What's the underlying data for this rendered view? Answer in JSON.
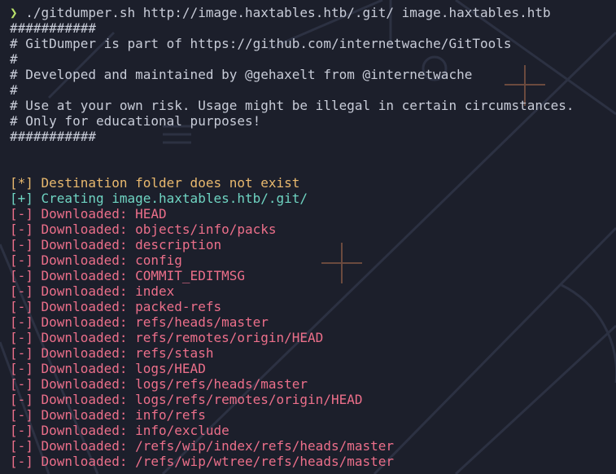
{
  "terminal": {
    "prompt_symbol": "❯",
    "command": " ./gitdumper.sh http://image.haxtables.htb/.git/ image.haxtables.htb",
    "banner": [
      "###########",
      "# GitDumper is part of https://github.com/internetwache/GitTools",
      "#",
      "# Developed and maintained by @gehaxelt from @internetwache",
      "#",
      "# Use at your own risk. Usage might be illegal in certain circumstances.",
      "# Only for educational purposes!",
      "###########"
    ],
    "warning_line": "[*] Destination folder does not exist",
    "info_line": "[+] Creating image.haxtables.htb/.git/",
    "download_prefix": "[-] Downloaded: ",
    "downloads": [
      "HEAD",
      "objects/info/packs",
      "description",
      "config",
      "COMMIT_EDITMSG",
      "index",
      "packed-refs",
      "refs/heads/master",
      "refs/remotes/origin/HEAD",
      "refs/stash",
      "logs/HEAD",
      "logs/refs/heads/master",
      "logs/refs/remotes/origin/HEAD",
      "info/refs",
      "info/exclude",
      "/refs/wip/index/refs/heads/master",
      "/refs/wip/wtree/refs/heads/master"
    ],
    "colors": {
      "background": "#1c1f2b",
      "prompt": "#b8e06a",
      "text": "#c8ccd8",
      "warning": "#e9b96e",
      "info": "#6fd4c2",
      "download": "#ec6f8a"
    }
  }
}
